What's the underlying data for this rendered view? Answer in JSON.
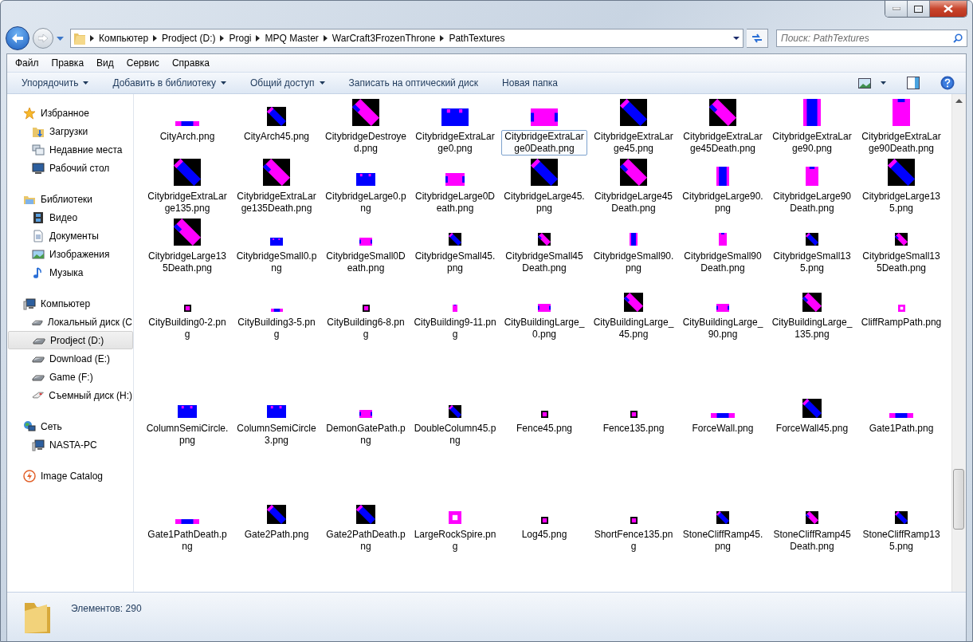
{
  "address": {
    "crumbs": [
      "Компьютер",
      "Prodject (D:)",
      "Progi",
      "MPQ Master",
      "WarCraft3FrozenThrone",
      "PathTextures"
    ]
  },
  "search": {
    "placeholder": "Поиск: PathTextures"
  },
  "menu": [
    "Файл",
    "Правка",
    "Вид",
    "Сервис",
    "Справка"
  ],
  "toolbar": [
    {
      "label": "Упорядочить",
      "has_menu": true
    },
    {
      "label": "Добавить в библиотеку",
      "has_menu": true
    },
    {
      "label": "Общий доступ",
      "has_menu": true
    },
    {
      "label": "Записать на оптический диск",
      "has_menu": false
    },
    {
      "label": "Новая папка",
      "has_menu": false
    }
  ],
  "sidebar": [
    {
      "label": "Избранное",
      "kind": "star",
      "selected": false,
      "children": [
        {
          "label": "Загрузки",
          "kind": "downloads",
          "selected": false
        },
        {
          "label": "Недавние места",
          "kind": "recent",
          "selected": false
        },
        {
          "label": "Рабочий стол",
          "kind": "desktop",
          "selected": false
        }
      ]
    },
    {
      "label": "Библиотеки",
      "kind": "library",
      "selected": false,
      "children": [
        {
          "label": "Видео",
          "kind": "video",
          "selected": false
        },
        {
          "label": "Документы",
          "kind": "document",
          "selected": false
        },
        {
          "label": "Изображения",
          "kind": "image",
          "selected": false
        },
        {
          "label": "Музыка",
          "kind": "music",
          "selected": false
        }
      ]
    },
    {
      "label": "Компьютер",
      "kind": "computer",
      "selected": false,
      "children": [
        {
          "label": "Локальный диск (C",
          "kind": "drive",
          "selected": false
        },
        {
          "label": "Prodject (D:)",
          "kind": "drive",
          "selected": true
        },
        {
          "label": "Download (E:)",
          "kind": "drive",
          "selected": false
        },
        {
          "label": "Game (F:)",
          "kind": "drive",
          "selected": false
        },
        {
          "label": "Съемный диск (H:)",
          "kind": "usb",
          "selected": false
        }
      ]
    },
    {
      "label": "Сеть",
      "kind": "network",
      "selected": false,
      "children": [
        {
          "label": "NASTA-PC",
          "kind": "computer",
          "selected": false
        }
      ]
    },
    {
      "label": "Image Catalog",
      "kind": "catalog",
      "selected": false
    }
  ],
  "files": [
    {
      "name": "CityArch.png",
      "kind": "strip-m",
      "selected": false
    },
    {
      "name": "CityArch45.png",
      "kind": "diag-m",
      "selected": false
    },
    {
      "name": "CitybridgeDestroyed.png",
      "kind": "diamond-l",
      "selected": false
    },
    {
      "name": "CitybridgeExtraLarge0.png",
      "kind": "wide-l",
      "selected": false
    },
    {
      "name": "CitybridgeExtraLarge0Death.png",
      "kind": "widepink-l",
      "selected": true
    },
    {
      "name": "CitybridgeExtraLarge45.png",
      "kind": "diag-l",
      "selected": false
    },
    {
      "name": "CitybridgeExtraLarge45Death.png",
      "kind": "diamond-l",
      "selected": false
    },
    {
      "name": "CitybridgeExtraLarge90.png",
      "kind": "tall-l",
      "selected": false
    },
    {
      "name": "CitybridgeExtraLarge90Death.png",
      "kind": "tallpink-l",
      "selected": false
    },
    {
      "name": "CitybridgeExtraLarge135.png",
      "kind": "diag-l",
      "selected": false
    },
    {
      "name": "CitybridgeExtraLarge135Death.png",
      "kind": "diamond-l",
      "selected": false
    },
    {
      "name": "CitybridgeLarge0.png",
      "kind": "wide-m",
      "selected": false
    },
    {
      "name": "CitybridgeLarge0Death.png",
      "kind": "widepink-m",
      "selected": false
    },
    {
      "name": "CitybridgeLarge45.png",
      "kind": "diag-l",
      "selected": false
    },
    {
      "name": "CitybridgeLarge45Death.png",
      "kind": "diamond-l",
      "selected": false
    },
    {
      "name": "CitybridgeLarge90.png",
      "kind": "tall-m",
      "selected": false
    },
    {
      "name": "CitybridgeLarge90Death.png",
      "kind": "tallpink-m",
      "selected": false
    },
    {
      "name": "CitybridgeLarge135.png",
      "kind": "diag-l",
      "selected": false
    },
    {
      "name": "CitybridgeLarge135Death.png",
      "kind": "diamond-l",
      "selected": false
    },
    {
      "name": "CitybridgeSmall0.png",
      "kind": "wide-s",
      "selected": false
    },
    {
      "name": "CitybridgeSmall0Death.png",
      "kind": "widepink-s",
      "selected": false
    },
    {
      "name": "CitybridgeSmall45.png",
      "kind": "diag-s",
      "selected": false
    },
    {
      "name": "CitybridgeSmall45Death.png",
      "kind": "diamond-s",
      "selected": false
    },
    {
      "name": "CitybridgeSmall90.png",
      "kind": "tall-s",
      "selected": false
    },
    {
      "name": "CitybridgeSmall90Death.png",
      "kind": "tallpink-s",
      "selected": false
    },
    {
      "name": "CitybridgeSmall135.png",
      "kind": "diag-s",
      "selected": false
    },
    {
      "name": "CitybridgeSmall135Death.png",
      "kind": "diamond-s",
      "selected": false
    },
    {
      "name": "CityBuilding0-2.png",
      "kind": "dot-xs",
      "selected": false
    },
    {
      "name": "CityBuilding3-5.png",
      "kind": "strip-xs",
      "selected": false
    },
    {
      "name": "CityBuilding6-8.png",
      "kind": "dot-xs",
      "selected": false
    },
    {
      "name": "CityBuilding9-11.png",
      "kind": "tallpink-xs",
      "selected": false
    },
    {
      "name": "CityBuildingLarge_0.png",
      "kind": "widepink-s",
      "selected": false
    },
    {
      "name": "CityBuildingLarge_45.png",
      "kind": "diamond-m",
      "selected": false
    },
    {
      "name": "CityBuildingLarge_90.png",
      "kind": "widepink-s",
      "selected": false
    },
    {
      "name": "CityBuildingLarge_135.png",
      "kind": "diamond-m",
      "selected": false
    },
    {
      "name": "CliffRampPath.png",
      "kind": "ring-xs",
      "selected": false
    },
    {
      "name": "ColumnSemiCircle.png",
      "kind": "wide-m",
      "selected": false
    },
    {
      "name": "ColumnSemiCircle3.png",
      "kind": "wide-m",
      "selected": false
    },
    {
      "name": "DemonGatePath.png",
      "kind": "widepink-s",
      "selected": false
    },
    {
      "name": "DoubleColumn45.png",
      "kind": "diag-s",
      "selected": false
    },
    {
      "name": "Fence45.png",
      "kind": "dot-xs",
      "selected": false
    },
    {
      "name": "Fence135.png",
      "kind": "dot-xs",
      "selected": false
    },
    {
      "name": "ForceWall.png",
      "kind": "strip-m",
      "selected": false
    },
    {
      "name": "ForceWall45.png",
      "kind": "diag-m",
      "selected": false
    },
    {
      "name": "Gate1Path.png",
      "kind": "strip-m",
      "selected": false
    },
    {
      "name": "Gate1PathDeath.png",
      "kind": "strip-m",
      "selected": false
    },
    {
      "name": "Gate2Path.png",
      "kind": "diag-m",
      "selected": false
    },
    {
      "name": "Gate2PathDeath.png",
      "kind": "diag-m",
      "selected": false
    },
    {
      "name": "LargeRockSpire.png",
      "kind": "ring-s",
      "selected": false
    },
    {
      "name": "Log45.png",
      "kind": "dot-xs",
      "selected": false
    },
    {
      "name": "ShortFence135.png",
      "kind": "dot-xs",
      "selected": false
    },
    {
      "name": "StoneCliffRamp45.png",
      "kind": "diag-s",
      "selected": false
    },
    {
      "name": "StoneCliffRamp45Death.png",
      "kind": "diamond-s",
      "selected": false
    },
    {
      "name": "StoneCliffRamp135.png",
      "kind": "diag-s",
      "selected": false
    }
  ],
  "status": {
    "count": "Элементов: 290"
  }
}
